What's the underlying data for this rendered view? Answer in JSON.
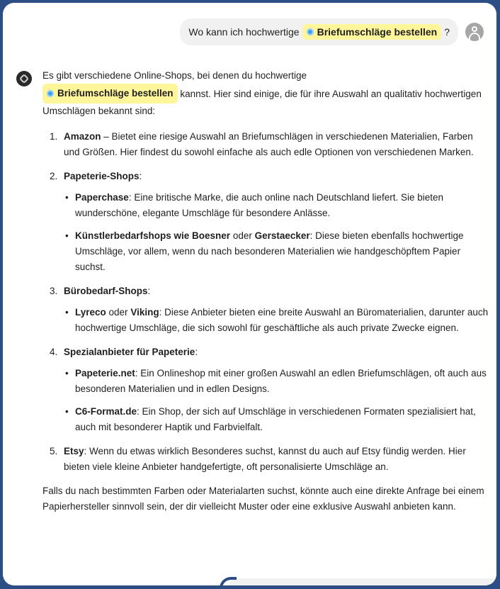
{
  "colors": {
    "frame_border": "#2d4d85",
    "highlight": "#fff59a",
    "dot": "#41a0ea",
    "bubble": "#f1f1f1"
  },
  "user": {
    "before": "Wo kann ich hochwertige",
    "highlight": "Briefumschläge bestellen",
    "after": "?",
    "avatar_icon": "person-icon"
  },
  "answer": {
    "bot_icon": "assistant-icon",
    "intro_before": "Es gibt verschiedene Online-Shops, bei denen du hochwertige",
    "intro_highlight": "Briefumschläge bestellen",
    "intro_after": "kannst. Hier sind einige, die für ihre Auswahl an qualitativ hochwertigen Umschlägen bekannt sind:",
    "items": [
      {
        "num": "1.",
        "bold": "Amazon",
        "text": " – Bietet eine riesige Auswahl an Briefumschlägen in verschiedenen Materialien, Farben und Größen. Hier findest du sowohl einfache als auch edle Optionen von verschiedenen Marken."
      },
      {
        "num": "2.",
        "bold": "Papeterie-Shops",
        "text": ":",
        "sub": [
          {
            "bold": "Paperchase",
            "text": ": Eine britische Marke, die auch online nach Deutschland liefert. Sie bieten wunderschöne, elegante Umschläge für besondere Anlässe."
          },
          {
            "bold": "Künstlerbedarfshops wie Boesner",
            "mid": " oder ",
            "bold2": "Gerstaecker",
            "text": ": Diese bieten ebenfalls hochwertige Umschläge, vor allem, wenn du nach besonderen Materialien wie handgeschöpftem Papier suchst."
          }
        ]
      },
      {
        "num": "3.",
        "bold": "Bürobedarf-Shops",
        "text": ":",
        "sub": [
          {
            "bold": "Lyreco",
            "mid": " oder ",
            "bold2": "Viking",
            "text": ": Diese Anbieter bieten eine breite Auswahl an Büromaterialien, darunter auch hochwertige Umschläge, die sich sowohl für geschäftliche als auch private Zwecke eignen."
          }
        ]
      },
      {
        "num": "4.",
        "bold": "Spezialanbieter für Papeterie",
        "text": ":",
        "sub": [
          {
            "bold": "Papeterie.net",
            "text": ": Ein Onlineshop mit einer großen Auswahl an edlen Briefumschlägen, oft auch aus besonderen Materialien und in edlen Designs."
          },
          {
            "bold": "C6-Format.de",
            "text": ": Ein Shop, der sich auf Umschläge in verschiedenen Formaten spezialisiert hat, auch mit besonderer Haptik und Farbvielfalt."
          }
        ]
      },
      {
        "num": "5.",
        "bold": "Etsy",
        "text": ": Wenn du etwas wirklich Besonderes suchst, kannst du auch auf Etsy fündig werden. Hier bieten viele kleine Anbieter handgefertigte, oft personalisierte Umschläge an."
      }
    ],
    "outro": "Falls du nach bestimmten Farben oder Materialarten suchst, könnte auch eine direkte Anfrage bei einem Papierhersteller sinnvoll sein, der dir vielleicht Muster oder eine exklusive Auswahl anbieten kann."
  }
}
